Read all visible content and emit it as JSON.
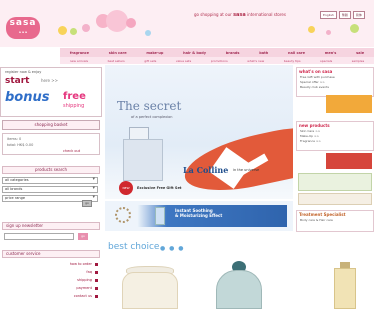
{
  "logo": {
    "name": "sasa",
    "tagline": "a a a"
  },
  "header": {
    "site_selector": "go shopping at our",
    "site_highlight": "sasa",
    "site_rest": "international stores",
    "languages": [
      "English",
      "繁體",
      "简体"
    ]
  },
  "nav": {
    "items": [
      "fragrance",
      "skin care",
      "make-up",
      "hair & body",
      "brands",
      "bath",
      "nail care",
      "men's",
      "sale"
    ],
    "subitems": [
      "new arrivals",
      "best sellers",
      "gift sets",
      "value sets",
      "promotions",
      "what's new",
      "beauty tips",
      "specials",
      "samples"
    ]
  },
  "left": {
    "register_title": "register now & enjoy",
    "register_start": "start",
    "register_here": "here >>",
    "register_bonus": "bonus",
    "register_free": "free",
    "register_shipping": "shipping",
    "basket_label": "shopping basket",
    "mini_items": [
      "items: 0",
      "total: HK$ 0.00"
    ],
    "check_label": "check out",
    "product_search": "products search",
    "selects": [
      "all categories",
      "all brands",
      "price range"
    ],
    "keyword_placeholder": "keyword",
    "go_label": "go",
    "newsletter_label": "sign up newsletter",
    "newsletter_placeholder": "email address",
    "newsletter_go": "go",
    "customer_service": "customer service",
    "cs_items": [
      "how to order",
      "faq",
      "shipping",
      "payment",
      "contact us"
    ]
  },
  "banner": {
    "title": "The secret",
    "subtitle": "of a perfect complexion",
    "brand": "La Colline",
    "brand_sub": "in the universe",
    "caption": "Exclusive Free Gift Set",
    "new_badge": "NEW"
  },
  "banner2": {
    "line1": "Instant Soothing",
    "line2": "& Moisturizing Effect"
  },
  "best_choice": {
    "title": "best choice",
    "dots": "● ● ●"
  },
  "right": {
    "box1_head": "what's on sasa",
    "box1_lines": [
      "Free Gift with purchase",
      "Special offer >>",
      "Beauty club events"
    ],
    "box2_head": "new products",
    "box2_lines": [
      "Skin Care >>",
      "Make-Up >>",
      "Fragrance >>"
    ],
    "box3_head": "Treatment Specialist",
    "box3_lines": [
      "Body care & Hair care"
    ]
  },
  "colors": {
    "brand_pink": "#e8698d",
    "nav_bg": "#f6d4e0",
    "accent_red": "#a0183f",
    "accent_blue": "#62a7d9"
  }
}
